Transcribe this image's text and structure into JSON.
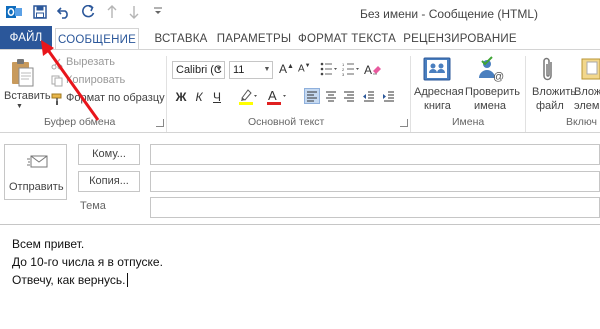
{
  "window": {
    "title": "Без имени - Сообщение (HTML)"
  },
  "quick_access": [
    {
      "icon": "outlook-logo-icon"
    },
    {
      "icon": "save-icon"
    },
    {
      "icon": "undo-icon"
    },
    {
      "icon": "redo-icon"
    },
    {
      "icon": "arrow-up-icon"
    },
    {
      "icon": "arrow-down-icon"
    },
    {
      "icon": "customize-dropdown-icon"
    }
  ],
  "tabs": [
    {
      "label": "ФАЙЛ",
      "active": false,
      "accent": "#2b579a"
    },
    {
      "label": "СООБЩЕНИЕ",
      "active": true
    },
    {
      "label": "ВСТАВКА"
    },
    {
      "label": "ПАРАМЕТРЫ"
    },
    {
      "label": "ФОРМАТ ТЕКСТА"
    },
    {
      "label": "РЕЦЕНЗИРОВАНИЕ"
    }
  ],
  "ribbon": {
    "clipboard": {
      "group_label": "Буфер обмена",
      "paste": "Вставить",
      "cut": "Вырезать",
      "copy": "Копировать",
      "format_painter": "Формат по образцу"
    },
    "basic_text": {
      "group_label": "Основной текст",
      "font_name": "Calibri (С",
      "font_size": "11",
      "bold": "Ж",
      "italic": "К",
      "underline": "Ч",
      "highlight_color": "#ffff00",
      "font_color": "#e02020"
    },
    "names": {
      "group_label": "Имена",
      "address_book_line1": "Адресная",
      "address_book_line2": "книга",
      "check_names_line1": "Проверить",
      "check_names_line2": "имена"
    },
    "include": {
      "group_label": "Включ",
      "attach_file_line1": "Вложить",
      "attach_file_line2": "файл",
      "attach_item_line1": "Влож",
      "attach_item_line2": "элеме"
    }
  },
  "compose": {
    "send_label": "Отправить",
    "to_button": "Кому...",
    "cc_button": "Копия...",
    "subject_label": "Тема",
    "body_lines": [
      "Всем привет.",
      "До 10-го числа я в отпуске.",
      "Отвечу, как вернусь."
    ]
  },
  "annotation": {
    "arrow_color": "#e8151b"
  }
}
